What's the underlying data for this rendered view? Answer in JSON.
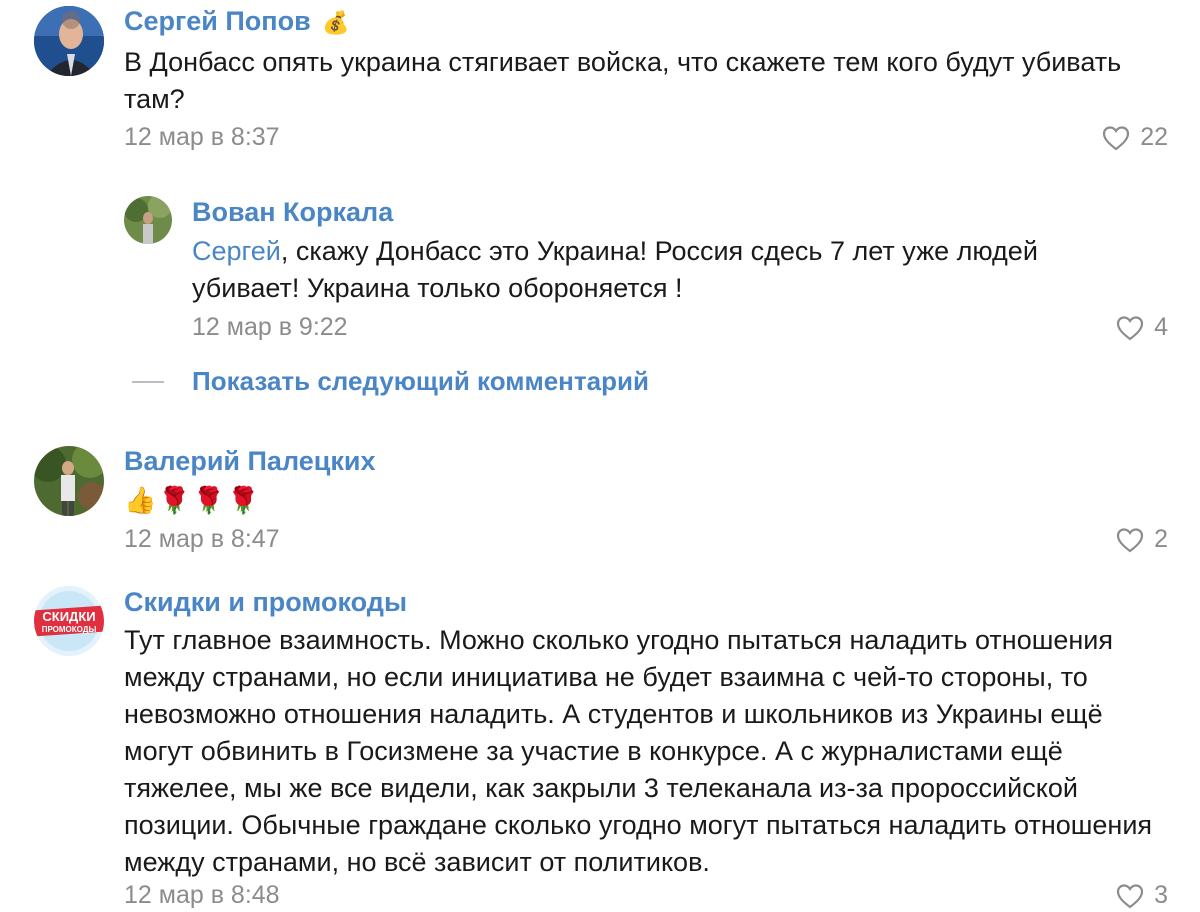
{
  "comments": [
    {
      "author": "Сергей Попов",
      "author_badge": "💰",
      "text": "В Донбасс опять украина стягивает войска, что скажете тем кого будут убивать там?",
      "date": "12 мар в 8:37",
      "likes": "22"
    },
    {
      "author": "Вован Коркала",
      "reply_to": "Сергей",
      "text": ", скажу Донбасс это Украина! Россия сдесь 7 лет уже людей убивает! Украина только обороняется !",
      "date": "12 мар в 9:22",
      "likes": "4"
    },
    {
      "author": "Валерий Палецких",
      "text": "👍🌹🌹🌹",
      "date": "12 мар в 8:47",
      "likes": "2"
    },
    {
      "author": "Скидки и промокоды",
      "text": "Тут главное взаимность. Можно сколько угодно пытаться наладить отношения между странами, но если инициатива не будет взаимна с чей-то стороны, то невозможно отношения наладить. А студентов и школьников из Украины ещё могут обвинить в Госизмене за участие в конкурсе. А с журналистами ещё тяжелее, мы же все видели, как закрыли 3 телеканала из-за пророссийской позиции. Обычные граждане сколько угодно могут пытаться наладить отношения между странами, но всё зависит от политиков.",
      "date": "12 мар в 8:48",
      "likes": "3",
      "avatar_logo": [
        "СКИДКИ",
        "ПРОМОКОДЫ"
      ]
    }
  ],
  "show_next_label": "Показать следующий комментарий",
  "icons": {
    "like": "heart-outline-icon"
  },
  "colors": {
    "link": "#4a86c5",
    "muted": "#8c8c8c",
    "text": "#1a1a1a"
  }
}
